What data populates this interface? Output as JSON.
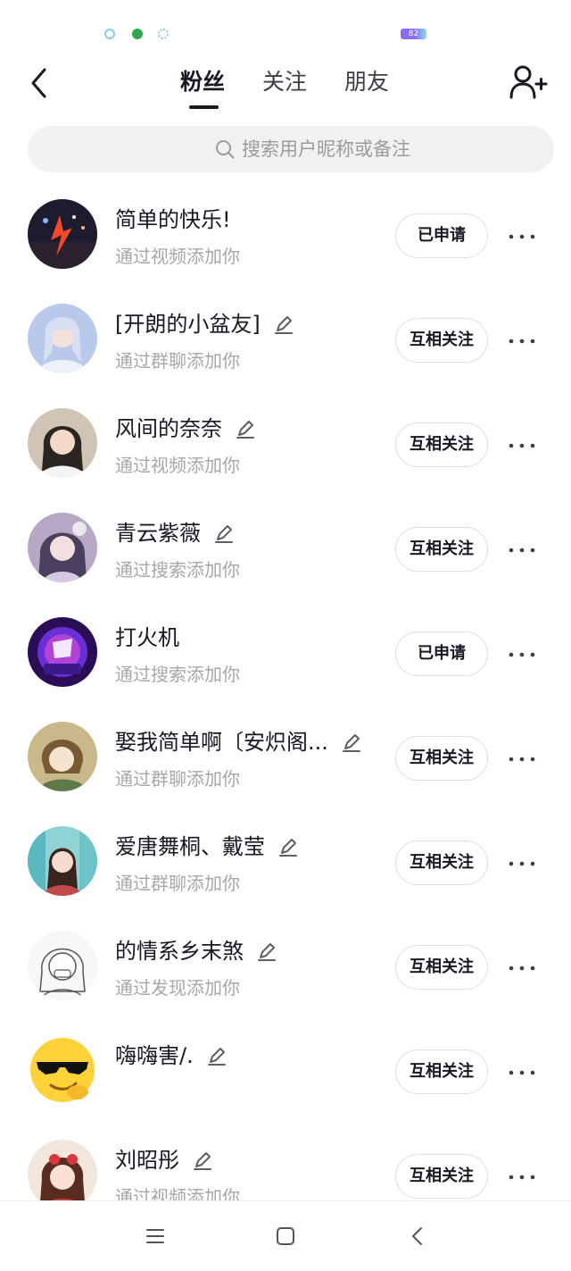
{
  "status_bar": {
    "battery_level": "82",
    "icons": [
      "notification-icon",
      "wechat-icon",
      "settings-icon"
    ]
  },
  "header": {
    "tabs": [
      {
        "label": "粉丝",
        "active": true
      },
      {
        "label": "关注",
        "active": false
      },
      {
        "label": "朋友",
        "active": false
      }
    ],
    "back_icon": "chevron-left-icon",
    "add_friend_icon": "add-user-icon"
  },
  "search": {
    "placeholder": "搜索用户昵称或备注",
    "icon": "search-icon"
  },
  "users": [
    {
      "name": "简单的快乐!",
      "source": "通过视频添加你",
      "action": "已申请",
      "has_edit": false
    },
    {
      "name": "[开朗的小盆友]",
      "source": "通过群聊添加你",
      "action": "互相关注",
      "has_edit": true
    },
    {
      "name": "风间的奈奈",
      "source": "通过视频添加你",
      "action": "互相关注",
      "has_edit": true
    },
    {
      "name": "青云紫薇",
      "source": "通过搜索添加你",
      "action": "互相关注",
      "has_edit": true
    },
    {
      "name": "打火机",
      "source": "通过搜索添加你",
      "action": "已申请",
      "has_edit": false
    },
    {
      "name": "娶我简单啊〔安炽阁...",
      "source": "通过群聊添加你",
      "action": "互相关注",
      "has_edit": true
    },
    {
      "name": "爱唐舞桐、戴莹",
      "source": "通过群聊添加你",
      "action": "互相关注",
      "has_edit": true
    },
    {
      "name": "的情系乡末煞",
      "source": "通过发现添加你",
      "action": "互相关注",
      "has_edit": true
    },
    {
      "name": "嗨嗨害/.",
      "source": "",
      "action": "互相关注",
      "has_edit": true
    },
    {
      "name": "刘昭彤",
      "source": "通过视频添加你",
      "action": "互相关注",
      "has_edit": true
    }
  ],
  "nav": {
    "icons": [
      "menu-icon",
      "home-icon",
      "back-icon"
    ]
  },
  "colors": {
    "text_primary": "#161823",
    "text_secondary": "#a6a7ab",
    "search_bg": "#f1f1f2",
    "button_border": "#dedee0"
  }
}
